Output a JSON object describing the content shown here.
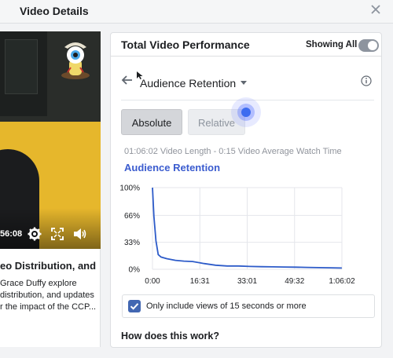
{
  "dialog": {
    "title": "Video Details"
  },
  "video": {
    "time": "56:08",
    "title": "eo Distribution, and",
    "description": [
      "Grace Duffy explore",
      "distribution, and updates",
      "r the impact of the CCP..."
    ]
  },
  "performance": {
    "title": "Total Video Performance",
    "showing_all_label": "Showing All",
    "showing_all_on": false,
    "metric": "Audience Retention",
    "buttons": {
      "absolute": "Absolute",
      "relative": "Relative"
    },
    "selected_button": "Absolute",
    "video_length_text": "01:06:02 Video Length - 0:15 Video Average Watch Time",
    "chart_heading": "Audience Retention",
    "checkbox_label": "Only include views of 15 seconds or more",
    "checkbox_checked": true,
    "how_link": "How does this work?"
  },
  "colors": {
    "accent": "#4267b2",
    "line": "#2d5bc9",
    "heading": "#3b5ccf"
  },
  "chart_data": {
    "type": "line",
    "title": "Audience Retention",
    "x_tick_labels": [
      "0:00",
      "16:31",
      "33:01",
      "49:32",
      "1:06:02"
    ],
    "y_tick_labels": [
      "100%",
      "66%",
      "33%",
      "0%"
    ],
    "xlim_minutes": [
      0,
      66.03
    ],
    "ylim": [
      0,
      100
    ],
    "grid": true,
    "series": [
      {
        "x_minutes": [
          0,
          0.5,
          1.2,
          2.0,
          3.0,
          5.0,
          8.0,
          11.0,
          14.0,
          18.0,
          22.0,
          26.0,
          30.0,
          34.0,
          38.0,
          42.0,
          46.0,
          50.0,
          54.0,
          58.0,
          62.0,
          66.0
        ],
        "y_percent": [
          100,
          65,
          35,
          18,
          15,
          13,
          11,
          10,
          9.5,
          7,
          5,
          4,
          4,
          3.5,
          3.2,
          3,
          2.8,
          2.6,
          2.3,
          2,
          1.8,
          1.5
        ]
      }
    ]
  }
}
